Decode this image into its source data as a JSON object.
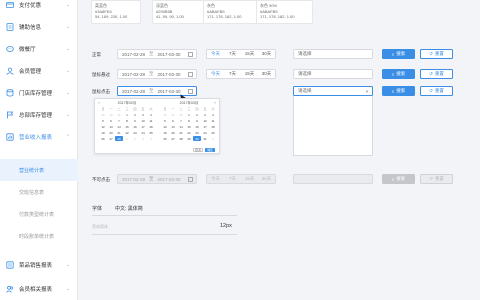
{
  "sidebar": {
    "items": [
      {
        "label": "支付优惠",
        "icon": "payment-icon",
        "expanded": false
      },
      {
        "label": "辅助信息",
        "icon": "info-icon",
        "expanded": false
      },
      {
        "label": "微餐厅",
        "icon": "wechat-icon",
        "expanded": false
      },
      {
        "label": "会员管理",
        "icon": "member-icon",
        "expanded": false
      },
      {
        "label": "门店库存管理",
        "icon": "store-inventory-icon",
        "expanded": false
      },
      {
        "label": "总部库存管理",
        "icon": "hq-inventory-icon",
        "expanded": false
      },
      {
        "label": "营业收入报表",
        "icon": "report-icon",
        "expanded": true
      }
    ],
    "sub_items": [
      {
        "label": "营业统计表",
        "active": true
      },
      {
        "label": "交班信息表",
        "active": false
      },
      {
        "label": "付款类型统计表",
        "active": false
      },
      {
        "label": "时段账单统计表",
        "active": false
      }
    ],
    "bottom_items": [
      {
        "label": "菜品销售报表",
        "icon": "dish-sales-icon"
      },
      {
        "label": "会员相关报表",
        "icon": "member-report-icon"
      }
    ]
  },
  "colors": [
    {
      "name": "菜蓝色",
      "hex": "#3A8FE6",
      "rgba": "54, 169, 230, 1.00"
    },
    {
      "name": "深蓝色",
      "hex": "#293B5B",
      "rgba": "41, 59, 90, 1.00"
    },
    {
      "name": "灰色",
      "hex": "#ABAFB5",
      "rgba": "171, 178, 182, 1.00"
    },
    {
      "name": "灰色  50%",
      "hex": "#ABAFB5",
      "rgba": "171, 178, 182, 1.00"
    }
  ],
  "rows": [
    {
      "label": "正常",
      "start": "2017-02-28",
      "end": "2017-03-30",
      "state": "normal"
    },
    {
      "label": "鼠标悬过",
      "start": "2017-02-28",
      "end": "2017-03-30",
      "state": "hover"
    },
    {
      "label": "鼠标点击",
      "start": "2017-02-28",
      "end": "2017-03-30",
      "state": "active"
    },
    {
      "label": "不可点击",
      "start": "2017-02-28",
      "end": "2017-03-30",
      "state": "disabled"
    }
  ],
  "range_sep": "至",
  "segments": [
    "今天",
    "7天",
    "15天",
    "30天"
  ],
  "select_placeholder": "请选择",
  "search_label": "搜索",
  "reset_label": "重置",
  "calendar": {
    "left_title": "2017年02月",
    "right_title": "2017年03月",
    "weekdays": [
      "日",
      "一",
      "二",
      "三",
      "四",
      "五",
      "六"
    ],
    "left_days": [
      "29",
      "30",
      "31",
      "1",
      "2",
      "3",
      "4",
      "5",
      "6",
      "7",
      "8",
      "9",
      "10",
      "11",
      "12",
      "13",
      "14",
      "15",
      "16",
      "17",
      "18",
      "19",
      "20",
      "21",
      "22",
      "23",
      "24",
      "25",
      "26",
      "27",
      "28",
      "1",
      "2",
      "3",
      "4"
    ],
    "right_days": [
      "26",
      "27",
      "28",
      "1",
      "2",
      "3",
      "4",
      "5",
      "6",
      "7",
      "8",
      "9",
      "10",
      "11",
      "12",
      "13",
      "14",
      "15",
      "16",
      "17",
      "18",
      "19",
      "20",
      "21",
      "22",
      "23",
      "24",
      "25",
      "26",
      "27",
      "28",
      "29",
      "30",
      "31",
      "1"
    ],
    "cancel": "取消",
    "ok": "确定"
  },
  "font": {
    "label": "字体",
    "chinese_label": "中文: 黑体简",
    "sample": "黑体简体",
    "size": "12px"
  }
}
